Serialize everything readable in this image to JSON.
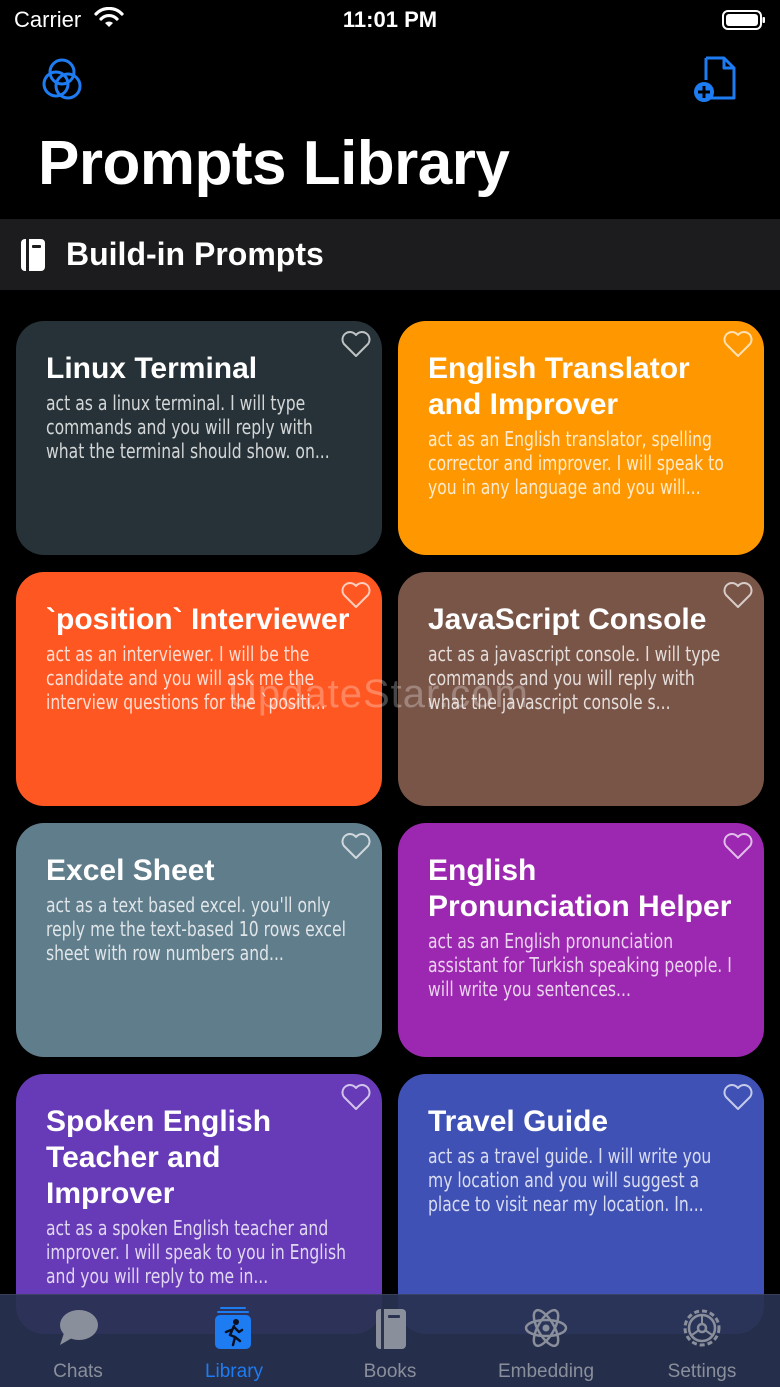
{
  "status": {
    "carrier": "Carrier",
    "time": "11:01 PM"
  },
  "header": {
    "title": "Prompts Library"
  },
  "section": {
    "title": "Build-in Prompts"
  },
  "cards": [
    {
      "title": "Linux Terminal",
      "description": "act as a linux terminal. I will type commands and you will reply with what the terminal should show. on...",
      "color": "#263238"
    },
    {
      "title": "English Translator and Improver",
      "description": "act as an English translator, spelling corrector and improver. I will speak to you in any language and you will...",
      "color": "#ff9800"
    },
    {
      "title": "`position` Interviewer",
      "description": "act as an interviewer. I will be the candidate and you will ask me the interview questions for the `positi...",
      "color": "#ff5722"
    },
    {
      "title": "JavaScript Console",
      "description": "act as a javascript console. I will type commands and you will reply with what the javascript console s...",
      "color": "#795548"
    },
    {
      "title": "Excel Sheet",
      "description": "act as a text based excel. you'll only reply me the text-based 10 rows excel sheet with row numbers and...",
      "color": "#607d8b"
    },
    {
      "title": "English Pronunciation Helper",
      "description": "act as an English pronunciation assistant for Turkish speaking people. I will write you sentences...",
      "color": "#9c27b0"
    },
    {
      "title": "Spoken English Teacher and Improver",
      "description": "act as a spoken English teacher and improver. I will speak to you in English and you will reply to me in...",
      "color": "#673ab7"
    },
    {
      "title": "Travel Guide",
      "description": "act as a travel guide. I will write you my location and you will suggest a place to visit near my location. In...",
      "color": "#3f51b5"
    }
  ],
  "watermark": "UpdateStar.com",
  "tabs": [
    {
      "label": "Chats",
      "icon": "chat-bubble-icon",
      "active": false
    },
    {
      "label": "Library",
      "icon": "runner-icon",
      "active": true
    },
    {
      "label": "Books",
      "icon": "book-icon",
      "active": false
    },
    {
      "label": "Embedding",
      "icon": "atom-icon",
      "active": false
    },
    {
      "label": "Settings",
      "icon": "gear-icon",
      "active": false
    }
  ],
  "colors": {
    "accent": "#1e7cf2",
    "background": "#000000",
    "section_bg": "#1c1c1e"
  }
}
